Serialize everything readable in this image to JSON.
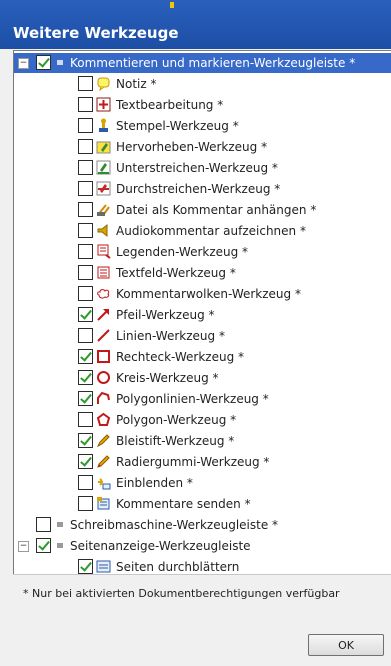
{
  "window": {
    "title": "Weitere Werkzeuge"
  },
  "tree": {
    "root": {
      "label": "Kommentieren und markieren-Werkzeugleiste *",
      "checked": true,
      "expanded": true
    },
    "items": [
      {
        "label": "Notiz *",
        "checked": false,
        "icon": "sticky-note-icon"
      },
      {
        "label": "Textbearbeitung *",
        "checked": false,
        "icon": "text-edit-icon"
      },
      {
        "label": "Stempel-Werkzeug *",
        "checked": false,
        "icon": "stamp-icon"
      },
      {
        "label": "Hervorheben-Werkzeug *",
        "checked": false,
        "icon": "highlight-icon"
      },
      {
        "label": "Unterstreichen-Werkzeug *",
        "checked": false,
        "icon": "underline-icon"
      },
      {
        "label": "Durchstreichen-Werkzeug *",
        "checked": false,
        "icon": "strikethrough-icon"
      },
      {
        "label": "Datei als Kommentar anhängen *",
        "checked": false,
        "icon": "attach-file-icon"
      },
      {
        "label": "Audiokommentar aufzeichnen *",
        "checked": false,
        "icon": "audio-icon"
      },
      {
        "label": "Legenden-Werkzeug *",
        "checked": false,
        "icon": "callout-icon"
      },
      {
        "label": "Textfeld-Werkzeug *",
        "checked": false,
        "icon": "textbox-icon"
      },
      {
        "label": "Kommentarwolken-Werkzeug *",
        "checked": false,
        "icon": "cloud-icon"
      },
      {
        "label": "Pfeil-Werkzeug *",
        "checked": true,
        "icon": "arrow-icon"
      },
      {
        "label": "Linien-Werkzeug *",
        "checked": false,
        "icon": "line-icon"
      },
      {
        "label": "Rechteck-Werkzeug *",
        "checked": true,
        "icon": "rectangle-icon"
      },
      {
        "label": "Kreis-Werkzeug *",
        "checked": true,
        "icon": "circle-icon"
      },
      {
        "label": "Polygonlinien-Werkzeug *",
        "checked": true,
        "icon": "polyline-icon"
      },
      {
        "label": "Polygon-Werkzeug *",
        "checked": false,
        "icon": "polygon-icon"
      },
      {
        "label": "Bleistift-Werkzeug *",
        "checked": true,
        "icon": "pencil-icon"
      },
      {
        "label": "Radiergummi-Werkzeug *",
        "checked": true,
        "icon": "eraser-icon"
      },
      {
        "label": "Einblenden *",
        "checked": false,
        "icon": "show-icon"
      },
      {
        "label": "Kommentare senden *",
        "checked": false,
        "icon": "send-comments-icon"
      }
    ],
    "group2": {
      "label": "Schreibmaschine-Werkzeugleiste *",
      "checked": false
    },
    "group3": {
      "label": "Seitenanzeige-Werkzeugleiste",
      "checked": true,
      "expanded": true
    },
    "group3_items": [
      {
        "label": "Seiten durchblättern",
        "checked": true,
        "icon": "page-navigation-icon"
      }
    ]
  },
  "footer": {
    "note": "* Nur bei aktivierten Dokumentberechtigungen verfügbar"
  },
  "buttons": {
    "ok": "OK"
  }
}
